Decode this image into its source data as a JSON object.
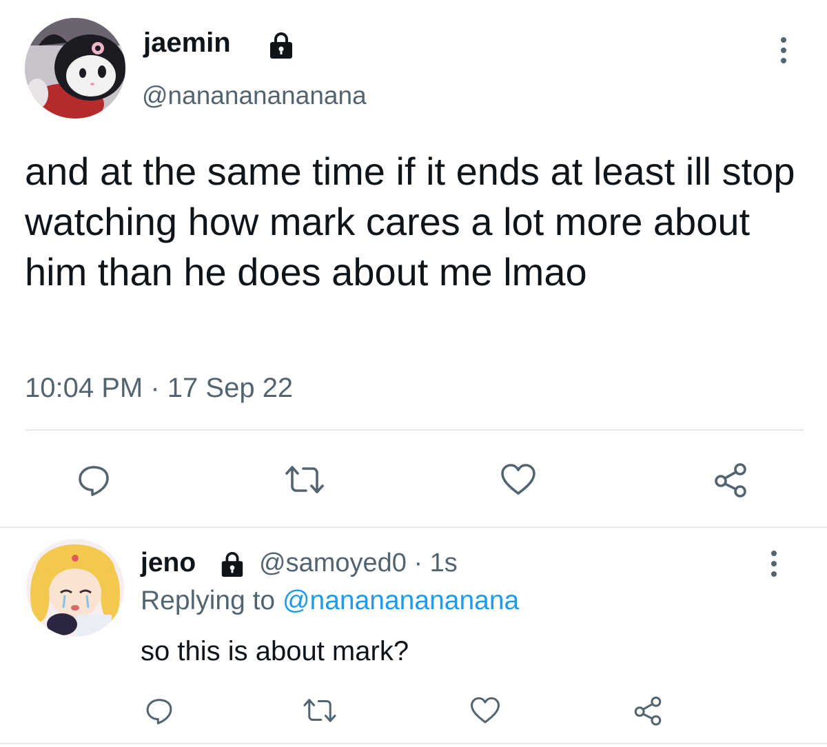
{
  "main_tweet": {
    "display_name": "jaemin",
    "handle": "@nanananananana",
    "text": "and at the same time if it ends at least ill stop watching how mark cares a lot more about him than he does about me lmao",
    "time": "10:04 PM",
    "separator": "·",
    "date": "17 Sep 22",
    "avatar_icon": "kuromi-avatar",
    "lock_icon": "lock-icon",
    "more_icon": "more-vertical-icon"
  },
  "actions": [
    {
      "name": "reply",
      "icon": "reply-icon"
    },
    {
      "name": "retweet",
      "icon": "retweet-icon"
    },
    {
      "name": "like",
      "icon": "heart-icon"
    },
    {
      "name": "share",
      "icon": "share-icon"
    }
  ],
  "reply_tweet": {
    "display_name": "jeno",
    "handle_line": "@samoyed0 · 1s",
    "replying_prefix": "Replying to ",
    "replying_mention": "@nanananananana",
    "text": "so this is about mark?",
    "avatar_icon": "sailor-moon-avatar"
  },
  "colors": {
    "text": "#0f1419",
    "secondary": "#536471",
    "mention": "#1d9bf0",
    "divider": "#e6e9eb"
  }
}
